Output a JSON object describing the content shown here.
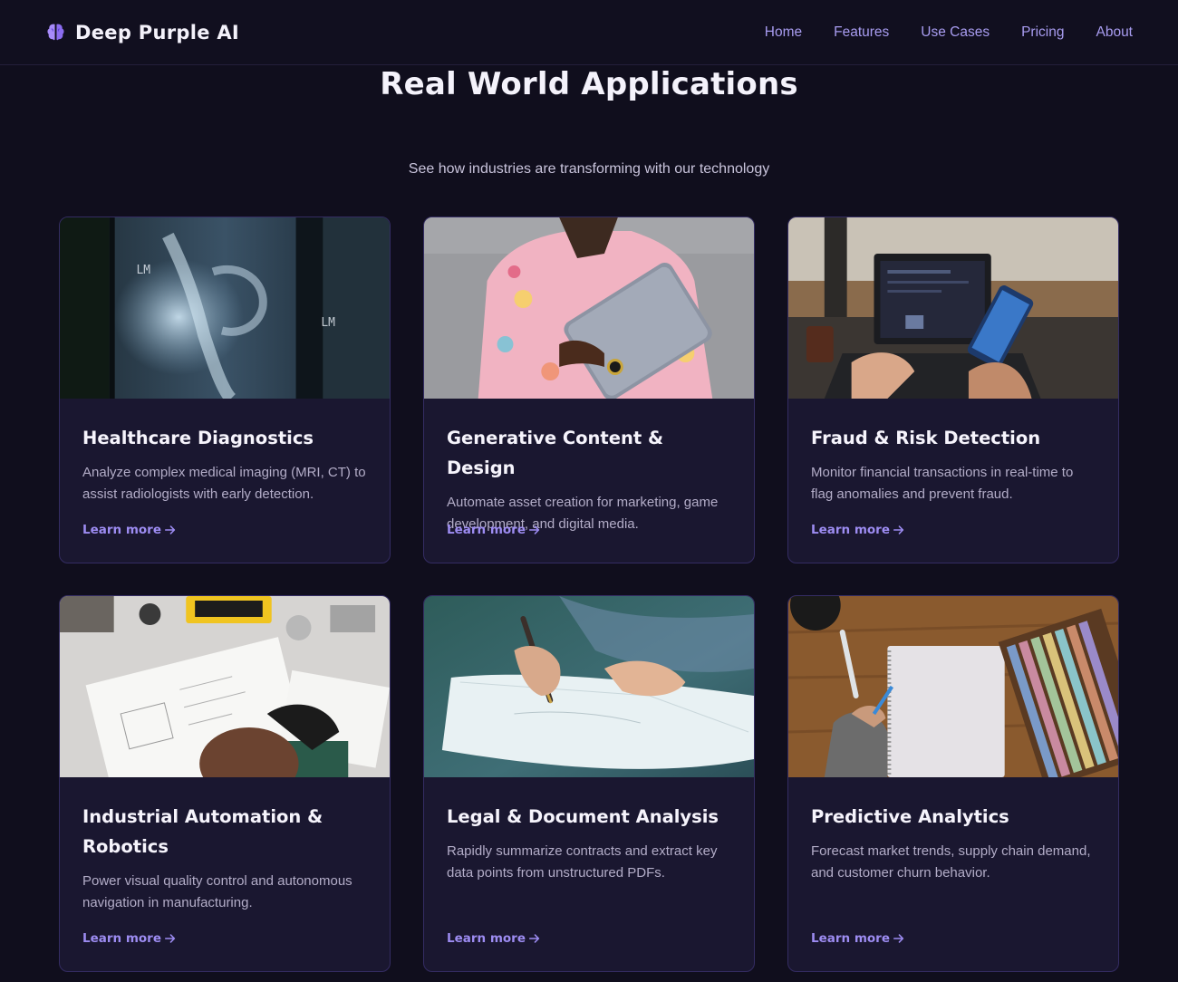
{
  "brand": {
    "name": "Deep Purple AI",
    "icon": "brain-icon",
    "accent": "#a78bfa"
  },
  "nav": {
    "items": [
      {
        "label": "Home"
      },
      {
        "label": "Features"
      },
      {
        "label": "Use Cases"
      },
      {
        "label": "Pricing"
      },
      {
        "label": "About"
      }
    ]
  },
  "section": {
    "title": "Real World Applications",
    "subtitle": "See how industries are transforming with our technology"
  },
  "cards": [
    {
      "title": "Healthcare Diagnostics",
      "description": "Analyze complex medical imaging (MRI, CT) to assist radiologists with early detection.",
      "link": "Learn more",
      "image": "x-ray hand photo"
    },
    {
      "title": "Generative Content & Design",
      "description": "Automate asset creation for marketing, game development, and digital media.",
      "link": "Learn more",
      "image": "person holding laptop photo"
    },
    {
      "title": "Fraud & Risk Detection",
      "description": "Monitor financial transactions in real-time to flag anomalies and prevent fraud.",
      "link": "Learn more",
      "image": "laptop and phone photo"
    },
    {
      "title": "Industrial Automation & Robotics",
      "description": "Power visual quality control and autonomous navigation in manufacturing.",
      "link": "Learn more",
      "image": "workbench sketching photo"
    },
    {
      "title": "Legal & Document Analysis",
      "description": "Rapidly summarize contracts and extract key data points from unstructured PDFs.",
      "link": "Learn more",
      "image": "signing document photo"
    },
    {
      "title": "Predictive Analytics",
      "description": "Forecast market trends, supply chain demand, and customer churn behavior.",
      "link": "Learn more",
      "image": "notebook and pastels photo"
    }
  ],
  "colors": {
    "background": "#100e1d",
    "card": "#1a1730",
    "card_border": "#342c63",
    "link": "#9d8cf2",
    "nav_link": "#a89cf0"
  }
}
